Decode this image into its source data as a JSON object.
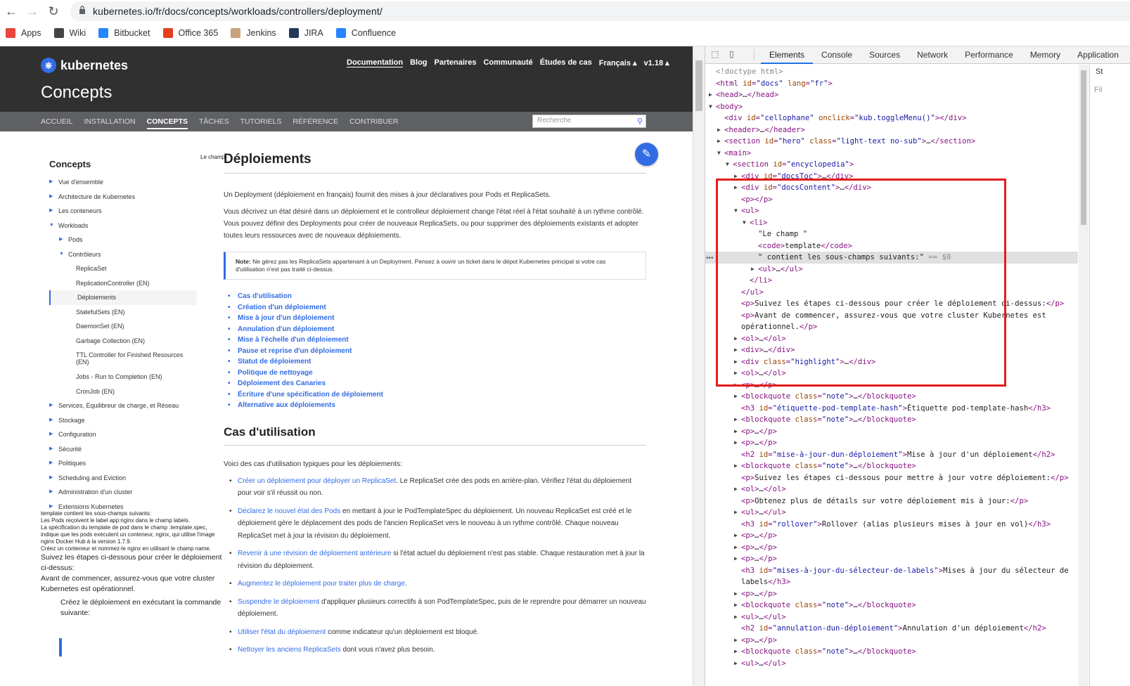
{
  "browser": {
    "url": "kubernetes.io/fr/docs/concepts/workloads/controllers/deployment/",
    "bookmarks": [
      {
        "label": "Apps",
        "icon": "apps-grid-icon",
        "color": "#e8453c"
      },
      {
        "label": "Wiki",
        "icon": "wiki-globe-icon",
        "color": "#444444"
      },
      {
        "label": "Bitbucket",
        "icon": "bitbucket-icon",
        "color": "#2684ff"
      },
      {
        "label": "Office 365",
        "icon": "office-icon",
        "color": "#e43e1c"
      },
      {
        "label": "Jenkins",
        "icon": "jenkins-icon",
        "color": "#c8a27a"
      },
      {
        "label": "JIRA",
        "icon": "jira-icon",
        "color": "#253858"
      },
      {
        "label": "Confluence",
        "icon": "confluence-icon",
        "color": "#2684ff"
      }
    ]
  },
  "site": {
    "logo": "kubernetes",
    "page_title": "Concepts",
    "topnav": [
      "Documentation",
      "Blog",
      "Partenaires",
      "Communauté",
      "Études de cas",
      "Français ▴",
      "v1.18 ▴"
    ],
    "subnav": [
      "ACCUEIL",
      "INSTALLATION",
      "CONCEPTS",
      "TÂCHES",
      "TUTORIELS",
      "RÉFÉRENCE",
      "CONTRIBUER"
    ],
    "search_placeholder": "Recherche",
    "accent": "#326ce5"
  },
  "sidebar": {
    "header": "Concepts",
    "items": [
      {
        "label": "Vue d'ensemble",
        "level": 0,
        "arrow": "▶"
      },
      {
        "label": "Architecture de Kubernetes",
        "level": 0,
        "arrow": "▶"
      },
      {
        "label": "Les conteneurs",
        "level": 0,
        "arrow": "▶"
      },
      {
        "label": "Workloads",
        "level": 0,
        "arrow": "▼"
      },
      {
        "label": "Pods",
        "level": 1,
        "arrow": "▶"
      },
      {
        "label": "Contrôleurs",
        "level": 1,
        "arrow": "▼"
      },
      {
        "label": "ReplicaSet",
        "level": 2,
        "arrow": ""
      },
      {
        "label": "ReplicationController (EN)",
        "level": 2,
        "arrow": ""
      },
      {
        "label": "Déploiements",
        "level": 2,
        "arrow": "",
        "selected": true
      },
      {
        "label": "StatefulSets (EN)",
        "level": 2,
        "arrow": ""
      },
      {
        "label": "DaemonSet (EN)",
        "level": 2,
        "arrow": ""
      },
      {
        "label": "Garbage Collection (EN)",
        "level": 2,
        "arrow": ""
      },
      {
        "label": "TTL Controller for Finished Resources (EN)",
        "level": 2,
        "arrow": "",
        "tall": true
      },
      {
        "label": "Jobs - Run to Completion (EN)",
        "level": 2,
        "arrow": ""
      },
      {
        "label": "CronJob (EN)",
        "level": 2,
        "arrow": ""
      },
      {
        "label": "Services, Equilibreur de charge, et Réseau",
        "level": 0,
        "arrow": "▶"
      },
      {
        "label": "Stockage",
        "level": 0,
        "arrow": "▶"
      },
      {
        "label": "Configuration",
        "level": 0,
        "arrow": "▶"
      },
      {
        "label": "Sécurité",
        "level": 0,
        "arrow": "▶"
      },
      {
        "label": "Politiques",
        "level": 0,
        "arrow": "▶"
      },
      {
        "label": "Scheduling and Eviction",
        "level": 0,
        "arrow": "▶"
      },
      {
        "label": "Administration d'un cluster",
        "level": 0,
        "arrow": "▶"
      },
      {
        "label": "Extensions Kubernetes",
        "level": 0,
        "arrow": "▶"
      }
    ]
  },
  "leaked": {
    "line1": "template contient les sous-champs suivants:",
    "line2": "Les Pods reçoivent le label app:nginx dans le champ labels.",
    "line3": "La spécification du template de pod dans le champ .template.spec, indique que les pods exécutent un conteneur, nginx, qui utilise l'image nginx Docker Hub à la version 1.7.9.",
    "line4": "Créez un conteneur et nommez-le nginx en utilisant le champ name.",
    "p1": "Suivez les étapes ci-dessous pour créer le déploiement ci-dessus:",
    "p2": "Avant de commencer, assurez-vous que votre cluster Kubernetes est opérationnel.",
    "p3": "Créez le déploiement en exécutant la commande suivante:",
    "lechamp": "Le champ"
  },
  "content": {
    "title": "Déploiements",
    "intro": "Un Deployment (déploiement en français) fournit des mises à jour déclaratives pour Pods et ReplicaSets.",
    "para2": "Vous décrivez un état désiré dans un déploiement et le controlleur déploiement change l'état réel à l'état souhaité à un rythme contrôlé. Vous pouvez définir des Deployments pour créer de nouveaux ReplicaSets, ou pour supprimer des déploiements existants et adopter toutes leurs ressources avec de nouveaux déploiements.",
    "note_label": "Note:",
    "note": " Ne gérez pas les ReplicaSets appartenant à un Deployment. Pensez à ouvrir un ticket dans le dépot Kubernetes principal si votre cas d'utilisation n'est pas traité ci-dessus.",
    "toc": [
      "Cas d'utilisation",
      "Création d'un déploiement",
      "Mise à jour d'un déploiement",
      "Annulation d'un déploiement",
      "Mise à l'échelle d'un déploiement",
      "Pause et reprise d'un déploiement",
      "Statut de déploiement",
      "Politique de nettoyage",
      "Déploiement des Canaries",
      "Écriture d'une spécification de déploiement",
      "Alternative aux déploiements"
    ],
    "h2": "Cas d'utilisation",
    "uses_intro": "Voici des cas d'utilisation typiques pour les déploiements:",
    "uses": [
      {
        "link": "Créer un déploiement pour déployer un ReplicaSet",
        "rest": ". Le ReplicaSet crée des pods en arrière-plan. Vérifiez l'état du déploiement pour voir s'il réussit ou non."
      },
      {
        "link": "Déclarez le nouvel état des Pods",
        "rest": " en mettant à jour le PodTemplateSpec du déploiement. Un nouveau ReplicaSet est créé et le déploiement gère le déplacement des pods de l'ancien ReplicaSet vers le nouveau à un rythme contrôlé. Chaque nouveau ReplicaSet met à jour la révision du déploiement."
      },
      {
        "link": "Revenir à une révision de déploiement antérieure",
        "rest": " si l'état actuel du déploiement n'est pas stable. Chaque restauration met à jour la révision du déploiement."
      },
      {
        "link": "Augmentez le déploiement pour traiter plus de charge",
        "rest": "."
      },
      {
        "link": "Suspendre le déploiement",
        "rest": " d'appliquer plusieurs correctifs à son PodTemplateSpec, puis de le reprendre pour démarrer un nouveau déploiement."
      },
      {
        "link": "Utiliser l'état du déploiement",
        "rest": " comme indicateur qu'un déploiement est bloqué."
      },
      {
        "link": "Nettoyer les anciens ReplicaSets",
        "rest": " dont vous n'avez plus besoin."
      }
    ]
  },
  "devtools": {
    "tabs": [
      "Elements",
      "Console",
      "Sources",
      "Network",
      "Performance",
      "Memory",
      "Application"
    ],
    "active_tab": "Elements",
    "side_tab": "St",
    "filter": "Fil",
    "lines": [
      {
        "i": 0,
        "a": "",
        "h": "<span class='dim'>&lt;!doctype html&gt;</span>"
      },
      {
        "i": 0,
        "a": "",
        "h": "<span class='tg'>&lt;html </span><span class='an'>id</span><span class='tg'>=</span><span class='av'>\"docs\"</span> <span class='an'>lang</span><span class='tg'>=</span><span class='av'>\"fr\"</span><span class='tg'>&gt;</span>"
      },
      {
        "i": 0,
        "a": "▶",
        "h": "<span class='tg'>&lt;head&gt;</span>…<span class='tg'>&lt;/head&gt;</span>"
      },
      {
        "i": 0,
        "a": "▼",
        "h": "<span class='tg'>&lt;body&gt;</span>"
      },
      {
        "i": 1,
        "a": "",
        "h": "<span class='tg'>&lt;div </span><span class='an'>id</span><span class='tg'>=</span><span class='av'>\"cellophane\"</span> <span class='an'>onclick</span><span class='tg'>=</span><span class='av'>\"kub.toggleMenu()\"</span><span class='tg'>&gt;&lt;/div&gt;</span>"
      },
      {
        "i": 1,
        "a": "▶",
        "h": "<span class='tg'>&lt;header&gt;</span>…<span class='tg'>&lt;/header&gt;</span>"
      },
      {
        "i": 1,
        "a": "▶",
        "h": "<span class='tg'>&lt;section </span><span class='an'>id</span><span class='tg'>=</span><span class='av'>\"hero\"</span> <span class='an'>class</span><span class='tg'>=</span><span class='av'>\"light-text no-sub\"</span><span class='tg'>&gt;</span>…<span class='tg'>&lt;/section&gt;</span>"
      },
      {
        "i": 1,
        "a": "▼",
        "h": "<span class='tg'>&lt;main&gt;</span>"
      },
      {
        "i": 2,
        "a": "▼",
        "h": "<span class='tg'>&lt;section </span><span class='an'>id</span><span class='tg'>=</span><span class='av'>\"encyclopedia\"</span><span class='tg'>&gt;</span>"
      },
      {
        "i": 3,
        "a": "▶",
        "h": "<span class='tg'>&lt;div </span><span class='an'>id</span><span class='tg'>=</span><span class='av'>\"docsToc\"</span><span class='tg'>&gt;</span>…<span class='tg'>&lt;/div&gt;</span>"
      },
      {
        "i": 3,
        "a": "▶",
        "h": "<span class='tg'>&lt;div </span><span class='an'>id</span><span class='tg'>=</span><span class='av'>\"docsContent\"</span><span class='tg'>&gt;</span>…<span class='tg'>&lt;/div&gt;</span>"
      },
      {
        "i": 3,
        "a": "",
        "h": "<span class='tg'>&lt;p&gt;&lt;/p&gt;</span>"
      },
      {
        "i": 3,
        "a": "▼",
        "h": "<span class='tg'>&lt;ul&gt;</span>"
      },
      {
        "i": 4,
        "a": "▼",
        "h": "<span class='tg'>&lt;li&gt;</span>"
      },
      {
        "i": 5,
        "a": "",
        "h": "<span class='tx'>\"Le champ \"</span>"
      },
      {
        "i": 5,
        "a": "",
        "h": "<span class='tg'>&lt;code&gt;</span>template<span class='tg'>&lt;/code&gt;</span>"
      },
      {
        "i": 5,
        "a": "",
        "hl": true,
        "h": "<span class='tx'>\" contient les sous-champs suivants:\"</span> <span class='dim'>== $0</span>"
      },
      {
        "i": 5,
        "a": "▶",
        "h": "<span class='tg'>&lt;ul&gt;</span>…<span class='tg'>&lt;/ul&gt;</span>"
      },
      {
        "i": 4,
        "a": "",
        "h": "<span class='tg'>&lt;/li&gt;</span>"
      },
      {
        "i": 3,
        "a": "",
        "h": "<span class='tg'>&lt;/ul&gt;</span>"
      },
      {
        "i": 3,
        "a": "",
        "h": "<span class='tg'>&lt;p&gt;</span>Suivez les étapes ci-dessous pour créer le déploiement ci-dessus:<span class='tg'>&lt;/p&gt;</span>"
      },
      {
        "i": 3,
        "a": "",
        "h": "<span class='tg'>&lt;p&gt;</span>Avant de commencer, assurez-vous que votre cluster Kubernetes est"
      },
      {
        "i": 3,
        "a": "",
        "h": "opérationnel.<span class='tg'>&lt;/p&gt;</span>"
      },
      {
        "i": 3,
        "a": "▶",
        "h": "<span class='tg'>&lt;ol&gt;</span>…<span class='tg'>&lt;/ol&gt;</span>"
      },
      {
        "i": 3,
        "a": "▶",
        "h": "<span class='tg'>&lt;div&gt;</span>…<span class='tg'>&lt;/div&gt;</span>"
      },
      {
        "i": 3,
        "a": "▶",
        "h": "<span class='tg'>&lt;div </span><span class='an'>class</span><span class='tg'>=</span><span class='av'>\"highlight\"</span><span class='tg'>&gt;</span>…<span class='tg'>&lt;/div&gt;</span>"
      },
      {
        "i": 3,
        "a": "▶",
        "h": "<span class='tg'>&lt;ol&gt;</span>…<span class='tg'>&lt;/ol&gt;</span>"
      },
      {
        "i": 3,
        "a": "▶",
        "h": "<span class='tg'>&lt;p&gt;</span>…<span class='tg'>&lt;/p&gt;</span>"
      },
      {
        "i": 3,
        "a": "▶",
        "h": "<span class='tg'>&lt;blockquote </span><span class='an'>class</span><span class='tg'>=</span><span class='av'>\"note\"</span><span class='tg'>&gt;</span>…<span class='tg'>&lt;/blockquote&gt;</span>"
      },
      {
        "i": 3,
        "a": "",
        "h": "<span class='tg'>&lt;h3 </span><span class='an'>id</span><span class='tg'>=</span><span class='av'>\"étiquette-pod-template-hash\"</span><span class='tg'>&gt;</span>Étiquette pod-template-hash<span class='tg'>&lt;/h3&gt;</span>"
      },
      {
        "i": 3,
        "a": "▶",
        "h": "<span class='tg'>&lt;blockquote </span><span class='an'>class</span><span class='tg'>=</span><span class='av'>\"note\"</span><span class='tg'>&gt;</span>…<span class='tg'>&lt;/blockquote&gt;</span>"
      },
      {
        "i": 3,
        "a": "▶",
        "h": "<span class='tg'>&lt;p&gt;</span>…<span class='tg'>&lt;/p&gt;</span>"
      },
      {
        "i": 3,
        "a": "▶",
        "h": "<span class='tg'>&lt;p&gt;</span>…<span class='tg'>&lt;/p&gt;</span>"
      },
      {
        "i": 3,
        "a": "",
        "h": "<span class='tg'>&lt;h2 </span><span class='an'>id</span><span class='tg'>=</span><span class='av'>\"mise-à-jour-dun-déploiement\"</span><span class='tg'>&gt;</span>Mise à jour d'un déploiement<span class='tg'>&lt;/h2&gt;</span>"
      },
      {
        "i": 3,
        "a": "▶",
        "h": "<span class='tg'>&lt;blockquote </span><span class='an'>class</span><span class='tg'>=</span><span class='av'>\"note\"</span><span class='tg'>&gt;</span>…<span class='tg'>&lt;/blockquote&gt;</span>"
      },
      {
        "i": 3,
        "a": "",
        "h": "<span class='tg'>&lt;p&gt;</span>Suivez les étapes ci-dessous pour mettre à jour votre déploiement:<span class='tg'>&lt;/p&gt;</span>"
      },
      {
        "i": 3,
        "a": "▶",
        "h": "<span class='tg'>&lt;ol&gt;</span>…<span class='tg'>&lt;/ol&gt;</span>"
      },
      {
        "i": 3,
        "a": "",
        "h": "<span class='tg'>&lt;p&gt;</span>Obtenez plus de détails sur votre déploiement mis à jour:<span class='tg'>&lt;/p&gt;</span>"
      },
      {
        "i": 3,
        "a": "▶",
        "h": "<span class='tg'>&lt;ul&gt;</span>…<span class='tg'>&lt;/ul&gt;</span>"
      },
      {
        "i": 3,
        "a": "",
        "h": "<span class='tg'>&lt;h3 </span><span class='an'>id</span><span class='tg'>=</span><span class='av'>\"rollover\"</span><span class='tg'>&gt;</span>Rollover (alias plusieurs mises à jour en vol)<span class='tg'>&lt;/h3&gt;</span>"
      },
      {
        "i": 3,
        "a": "▶",
        "h": "<span class='tg'>&lt;p&gt;</span>…<span class='tg'>&lt;/p&gt;</span>"
      },
      {
        "i": 3,
        "a": "▶",
        "h": "<span class='tg'>&lt;p&gt;</span>…<span class='tg'>&lt;/p&gt;</span>"
      },
      {
        "i": 3,
        "a": "▶",
        "h": "<span class='tg'>&lt;p&gt;</span>…<span class='tg'>&lt;/p&gt;</span>"
      },
      {
        "i": 3,
        "a": "",
        "h": "<span class='tg'>&lt;h3 </span><span class='an'>id</span><span class='tg'>=</span><span class='av'>\"mises-à-jour-du-sélecteur-de-labels\"</span><span class='tg'>&gt;</span>Mises à jour du sélecteur de"
      },
      {
        "i": 3,
        "a": "",
        "h": "labels<span class='tg'>&lt;/h3&gt;</span>"
      },
      {
        "i": 3,
        "a": "▶",
        "h": "<span class='tg'>&lt;p&gt;</span>…<span class='tg'>&lt;/p&gt;</span>"
      },
      {
        "i": 3,
        "a": "▶",
        "h": "<span class='tg'>&lt;blockquote </span><span class='an'>class</span><span class='tg'>=</span><span class='av'>\"note\"</span><span class='tg'>&gt;</span>…<span class='tg'>&lt;/blockquote&gt;</span>"
      },
      {
        "i": 3,
        "a": "▶",
        "h": "<span class='tg'>&lt;ul&gt;</span>…<span class='tg'>&lt;/ul&gt;</span>"
      },
      {
        "i": 3,
        "a": "",
        "h": "<span class='tg'>&lt;h2 </span><span class='an'>id</span><span class='tg'>=</span><span class='av'>\"annulation-dun-déploiement\"</span><span class='tg'>&gt;</span>Annulation d'un déploiement<span class='tg'>&lt;/h2&gt;</span>"
      },
      {
        "i": 3,
        "a": "▶",
        "h": "<span class='tg'>&lt;p&gt;</span>…<span class='tg'>&lt;/p&gt;</span>"
      },
      {
        "i": 3,
        "a": "▶",
        "h": "<span class='tg'>&lt;blockquote </span><span class='an'>class</span><span class='tg'>=</span><span class='av'>\"note\"</span><span class='tg'>&gt;</span>…<span class='tg'>&lt;/blockquote&gt;</span>"
      },
      {
        "i": 3,
        "a": "▶",
        "h": "<span class='tg'>&lt;ul&gt;</span>…<span class='tg'>&lt;/ul&gt;</span>"
      }
    ]
  }
}
